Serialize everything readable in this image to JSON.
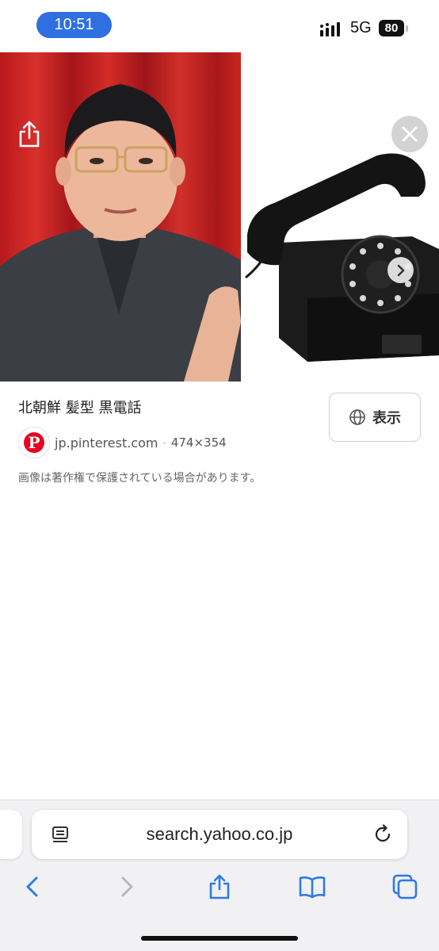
{
  "status_bar": {
    "time": "10:51",
    "network": "5G",
    "battery": "80"
  },
  "image_viewer": {
    "title": "北朝鮮 髪型 黒電話",
    "view_button_label": "表示",
    "source_domain": "jp.pinterest.com",
    "separator": "-",
    "image_size": "474×354",
    "pinterest_logo_letter": "P",
    "copyright_notice": "画像は著作権で保護されている場合があります。"
  },
  "browser": {
    "url": "search.yahoo.co.jp"
  },
  "colors": {
    "time_pill": "#2f6fe0",
    "pinterest_red": "#e60023",
    "ios_blue": "#2f7ae5"
  },
  "icons": [
    "share-icon",
    "close-icon",
    "chevron-right-icon",
    "globe-icon",
    "reader-icon",
    "reload-icon",
    "back-icon",
    "forward-icon",
    "bookmarks-icon",
    "tabs-icon"
  ]
}
